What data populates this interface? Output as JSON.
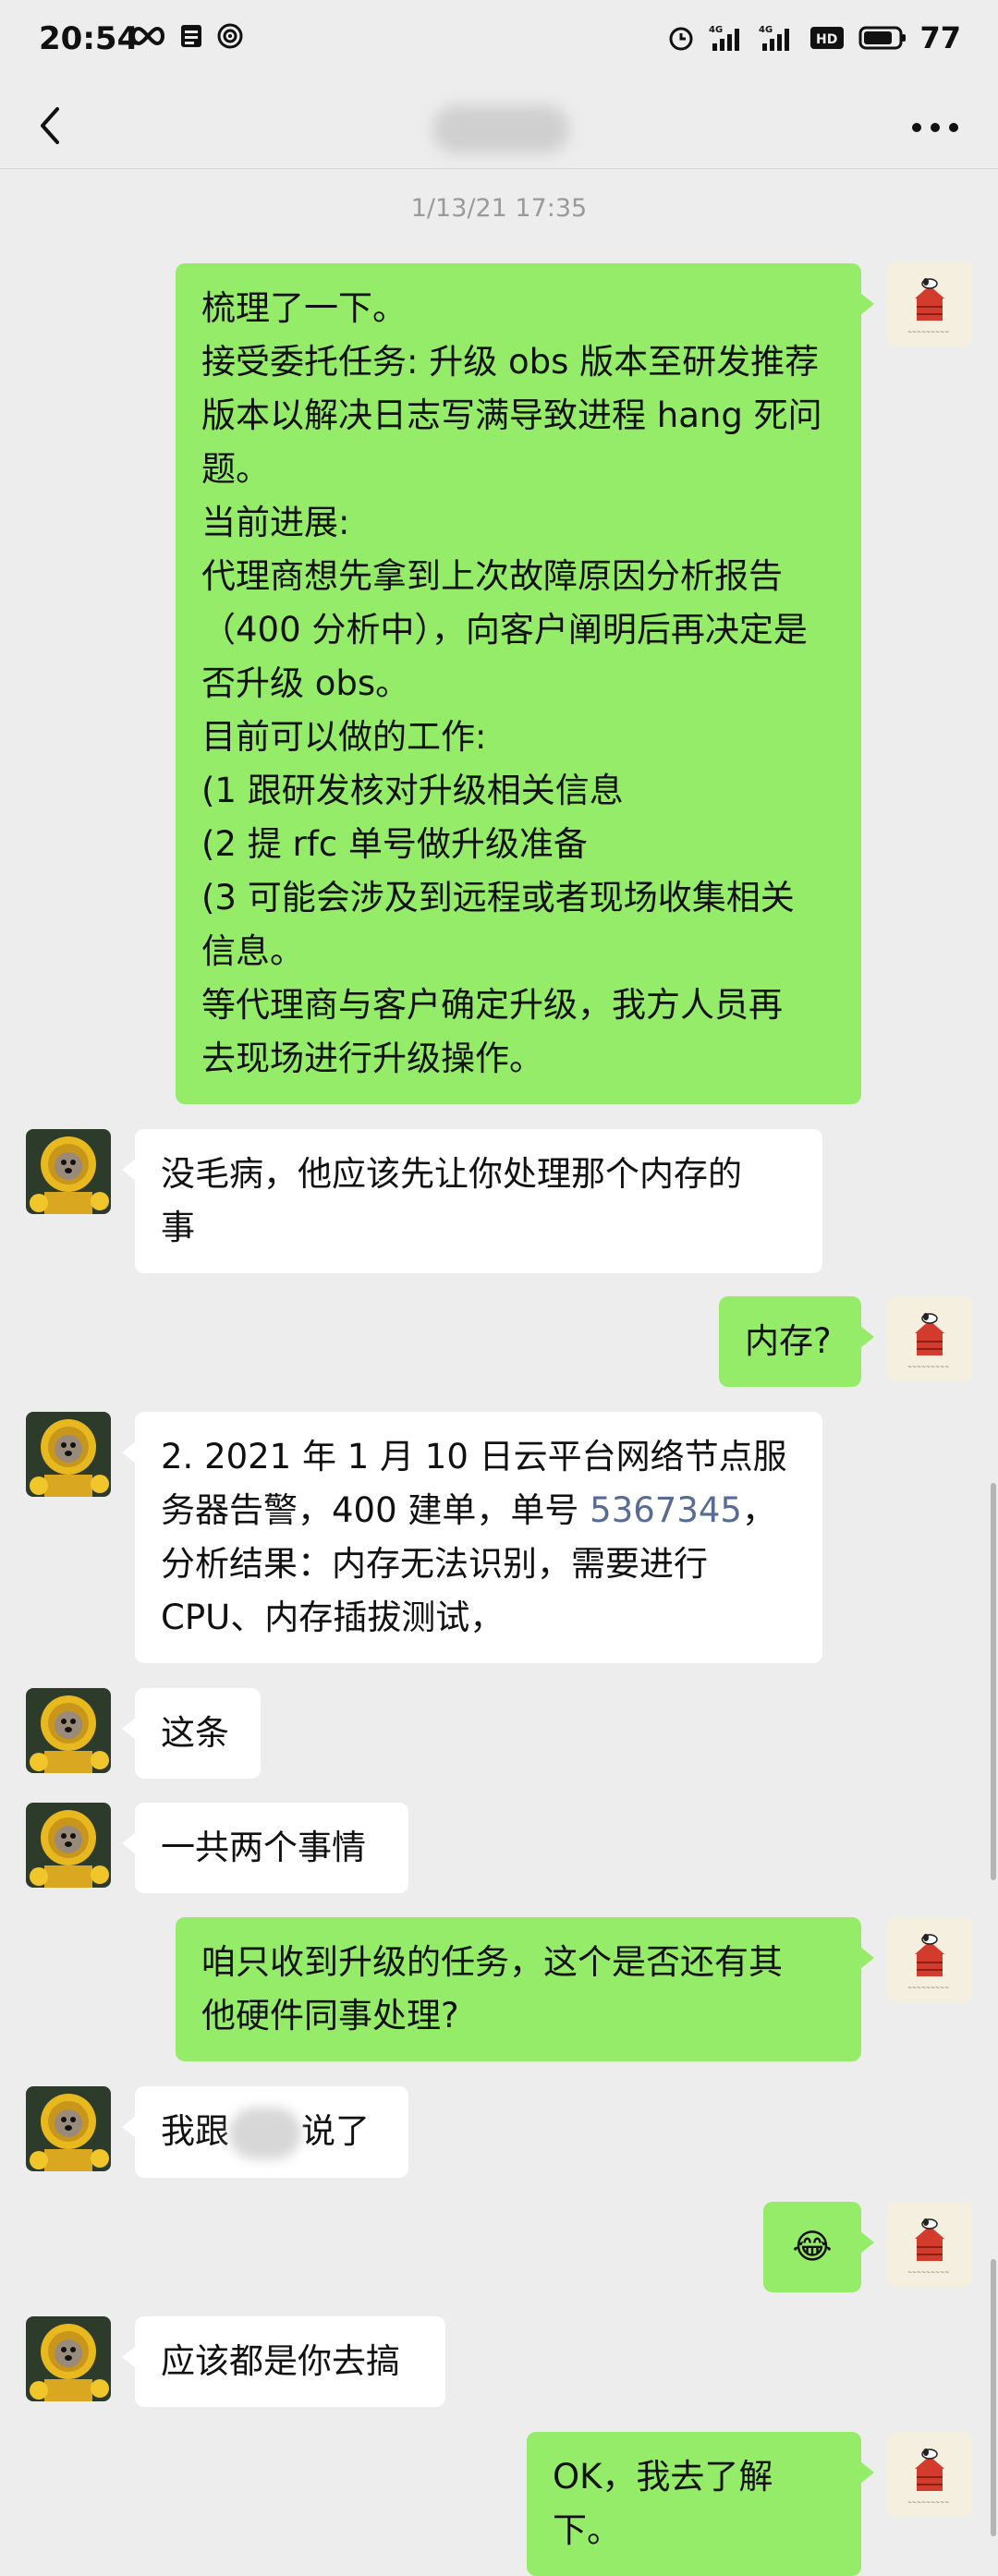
{
  "status_bar": {
    "time": "20:54",
    "battery": "77",
    "network_labels": [
      "4G",
      "4G"
    ],
    "hd_label": "HD"
  },
  "nav": {
    "title": ""
  },
  "chat": {
    "timestamp": "1/13/21 17:35",
    "messages": [
      {
        "sender": "me",
        "lines": [
          "梳理了一下。",
          "接受委托任务: 升级 obs 版本至研发推荐",
          "版本以解决日志写满导致进程 hang 死问",
          "题。",
          "当前进展:",
          "代理商想先拿到上次故障原因分析报告",
          "（400 分析中），向客户阐明后再决定是",
          "否升级 obs。",
          "目前可以做的工作:",
          "(1 跟研发核对升级相关信息",
          "(2 提 rfc 单号做升级准备",
          "(3 可能会涉及到远程或者现场收集相关",
          "信息。",
          "等代理商与客户确定升级，我方人员再",
          "去现场进行升级操作。"
        ]
      },
      {
        "sender": "other",
        "lines": [
          "没毛病，他应该先让你处理那个内存的",
          "事"
        ]
      },
      {
        "sender": "me",
        "text": "内存?"
      },
      {
        "sender": "other",
        "line1": "2. 2021 年 1 月 10 日云平台网络节点服",
        "line2_prefix": "务器告警，400 建单，单号 ",
        "line2_link": "5367345",
        "line2_suffix": "，",
        "line3": "分析结果：内存无法识别，需要进行",
        "line4": "CPU、内存插拔测试，"
      },
      {
        "sender": "other",
        "text": "这条"
      },
      {
        "sender": "other",
        "text": "一共两个事情"
      },
      {
        "sender": "me",
        "lines": [
          "咱只收到升级的任务，这个是否还有其",
          "他硬件同事处理?"
        ]
      },
      {
        "sender": "other",
        "prefix": "我跟",
        "suffix": "说了"
      },
      {
        "sender": "me",
        "emoji": "😂"
      },
      {
        "sender": "other",
        "text": "应该都是你去搞"
      },
      {
        "sender": "me",
        "text": "OK，我去了解下。"
      }
    ]
  },
  "colors": {
    "background": "#ededed",
    "my_bubble": "#95ec69",
    "other_bubble": "#ffffff",
    "link": "#576b95"
  },
  "icons": {
    "my_avatar": "snoopy-doghouse-avatar",
    "other_avatar": "sunflower-dog-avatar"
  }
}
